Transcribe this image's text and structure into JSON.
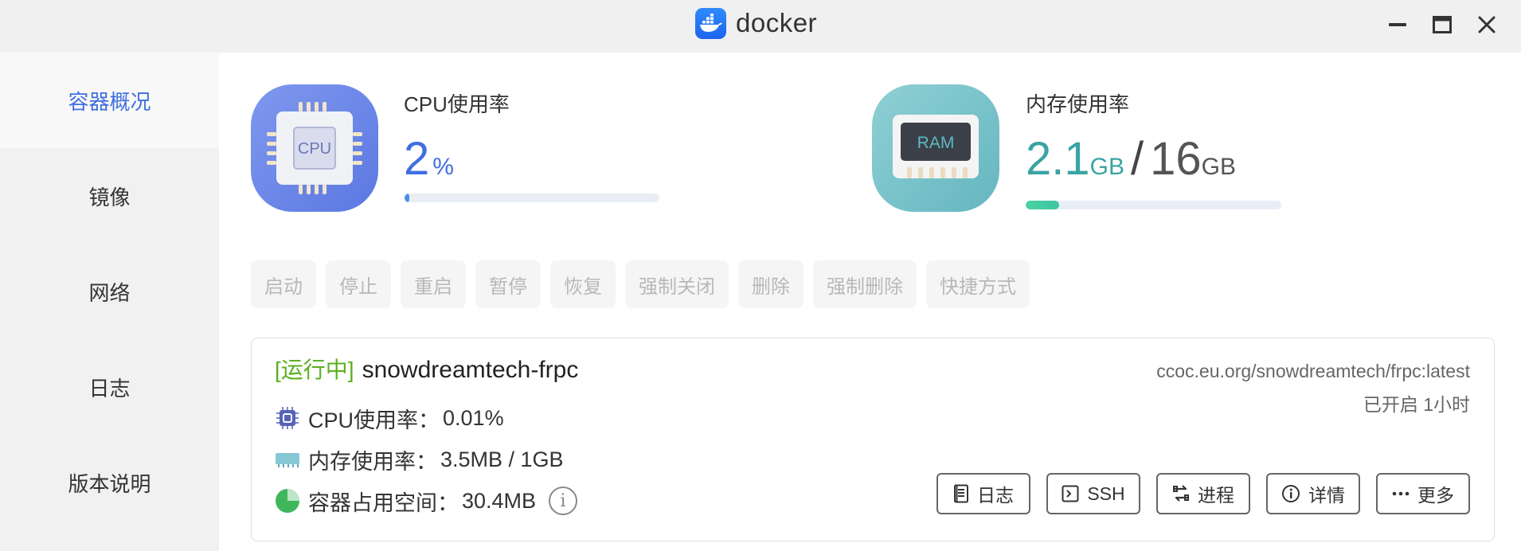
{
  "window": {
    "title": "docker",
    "icons": {
      "logo": "docker-whale-icon",
      "minimize": "minimize-icon",
      "maximize": "maximize-icon",
      "close": "close-icon"
    }
  },
  "sidebar": {
    "items": [
      {
        "label": "容器概况",
        "active": true
      },
      {
        "label": "镜像",
        "active": false
      },
      {
        "label": "网络",
        "active": false
      },
      {
        "label": "日志",
        "active": false
      },
      {
        "label": "版本说明",
        "active": false
      }
    ]
  },
  "cpu": {
    "label": "CPU使用率",
    "value": "2",
    "unit": "%",
    "percent": 2,
    "icon_text": "CPU"
  },
  "ram": {
    "label": "内存使用率",
    "used": "2.1",
    "used_unit": "GB",
    "separator": "/",
    "total": "16",
    "total_unit": "GB",
    "percent": 13,
    "icon_text": "RAM"
  },
  "toolbar": {
    "buttons": [
      "启动",
      "停止",
      "重启",
      "暂停",
      "恢复",
      "强制关闭",
      "删除",
      "强制删除",
      "快捷方式"
    ]
  },
  "container": {
    "status": "[运行中]",
    "name": "snowdreamtech-frpc",
    "image": "ccoc.eu.org/snowdreamtech/frpc:latest",
    "uptime": "已开启 1小时",
    "cpu_label": "CPU使用率：",
    "cpu_value": "0.01%",
    "mem_label": "内存使用率：",
    "mem_value": "3.5MB / 1GB",
    "disk_label": "容器占用空间：",
    "disk_value": "30.4MB",
    "actions": {
      "logs": "日志",
      "ssh": "SSH",
      "process": "进程",
      "details": "详情",
      "more": "更多"
    }
  },
  "colors": {
    "accent": "#3f6fe0",
    "running": "#5cb021",
    "ram_accent": "#3aa4a3"
  }
}
